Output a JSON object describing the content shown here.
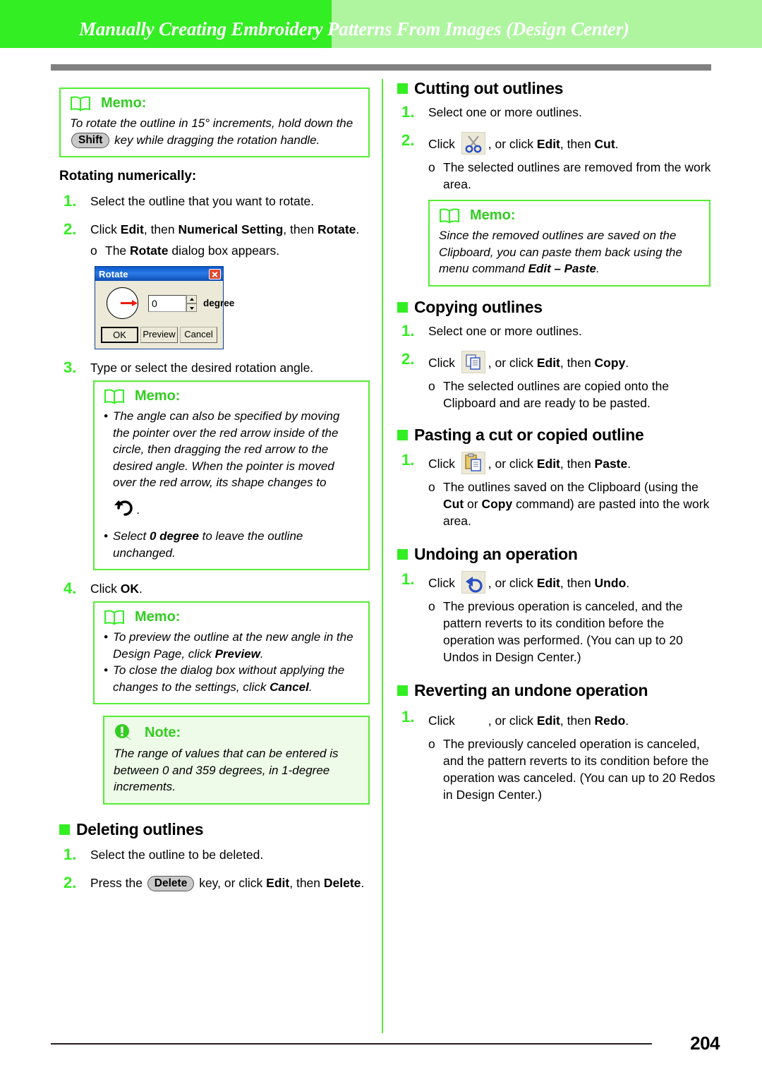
{
  "header": {
    "title": "Manually Creating Embroidery Patterns From Images (Design Center)",
    "color_dark": "#33ee22",
    "color_light": "#aff5a0"
  },
  "footer": {
    "page_number": "204"
  },
  "labels": {
    "memo": "Memo:",
    "note": "Note:",
    "book_icon": "book-icon",
    "warning_icon": "warning-icon"
  },
  "left_column": {
    "memo_rotate_increments": {
      "title": "Memo:",
      "text_before_key": "To rotate the outline in 15° increments, hold down the ",
      "key": "Shift",
      "text_after_key": " key while dragging the rotation handle."
    },
    "subheading_rotating_numerically": "Rotating numerically:",
    "steps": [
      {
        "num": "1.",
        "text": "Select the outline that you want to rotate."
      },
      {
        "num": "2.",
        "part1": "Click ",
        "b1": "Edit",
        "part2": ", then ",
        "b2": "Numerical Setting",
        "part3": ", then ",
        "b3": "Rotate",
        "part4": "."
      },
      {
        "num": "3.",
        "text": "Type or select the desired rotation angle."
      },
      {
        "num": "4.",
        "part1": "Click ",
        "b1": "OK",
        "part2": "."
      }
    ],
    "step2_sub": {
      "marker": "o",
      "part1": "The ",
      "b1": "Rotate",
      "part2": " dialog box appears."
    },
    "rotate_dialog": {
      "title": "Rotate",
      "close_icon": "close-icon",
      "value": "0",
      "unit_label": "degree",
      "buttons": [
        "OK",
        "Preview",
        "Cancel"
      ]
    },
    "memo_angle": {
      "title": "Memo:",
      "bullet1": "The angle can also be specified by moving the pointer over the red arrow inside of the circle, then dragging the red arrow to the desired angle. When the pointer is moved over the red arrow, its shape changes to",
      "bullet1_trailing": ".",
      "bullet2_part1": "Select ",
      "bullet2_bold": "0 degree",
      "bullet2_part2": " to leave the outline unchanged."
    },
    "memo_preview": {
      "title": "Memo:",
      "b1_part1": "To preview the outline at the new angle in the Design Page, click ",
      "b1_bold": "Preview",
      "b1_part2": ".",
      "b2_part1": "To close the dialog box without applying the changes to the settings, click ",
      "b2_bold": "Cancel",
      "b2_part2": "."
    },
    "note_range": {
      "title": "Note:",
      "text": "The range of values that can be entered is between 0 and 359 degrees, in 1-degree increments."
    },
    "deleting_outlines": {
      "heading": "Deleting outlines",
      "step1": {
        "num": "1.",
        "text": "Select the outline to be deleted."
      },
      "step2": {
        "num": "2.",
        "part1": "Press the ",
        "key": "Delete",
        "part2": " key, or click ",
        "b1": "Edit",
        "part3": ", then ",
        "b2": "Delete",
        "part4": "."
      }
    }
  },
  "right_column": {
    "cutting_out_outlines": {
      "heading": "Cutting out outlines",
      "step1": {
        "num": "1.",
        "text": "Select one or more outlines."
      },
      "step2": {
        "num": "2.",
        "part1": "Click ",
        "icon": "scissors-icon",
        "part2": ", or click ",
        "b1": "Edit",
        "part3": ", then ",
        "b2": "Cut",
        "part4": "."
      },
      "sub": {
        "marker": "o",
        "text": "The selected outlines are removed from the work area."
      },
      "memo": {
        "title": "Memo:",
        "part1": "Since the removed outlines are saved on the Clipboard, you can paste them back using the menu command ",
        "bold1": "Edit – Paste",
        "part2": "."
      }
    },
    "copying_outlines": {
      "heading": "Copying outlines",
      "step1": {
        "num": "1.",
        "text": "Select one or more outlines."
      },
      "step2": {
        "num": "2.",
        "part1": "Click ",
        "icon": "copy-icon",
        "part2": ", or click ",
        "b1": "Edit",
        "part3": ", then ",
        "b2": "Copy",
        "part4": "."
      },
      "sub": {
        "marker": "o",
        "text": "The selected outlines are copied onto the Clipboard and are ready to be pasted."
      }
    },
    "pasting_outline": {
      "heading": "Pasting a cut or copied outline",
      "step1": {
        "num": "1.",
        "part1": "Click ",
        "icon": "paste-icon",
        "part2": ", or click ",
        "b1": "Edit",
        "part3": ", then ",
        "b2": "Paste",
        "part4": "."
      },
      "sub": {
        "marker": "o",
        "part1": "The outlines saved on the Clipboard (using the ",
        "b1": "Cut",
        "part2": " or ",
        "b2": "Copy",
        "part3": " command) are pasted into the work area."
      }
    },
    "undoing_operation": {
      "heading": "Undoing an operation",
      "step1": {
        "num": "1.",
        "part1": "Click ",
        "icon": "undo-icon",
        "part2": ", or click ",
        "b1": "Edit",
        "part3": ", then ",
        "b2": "Undo",
        "part4": "."
      },
      "sub": {
        "marker": "o",
        "text": "The previous operation is canceled, and the pattern reverts to its condition before the operation was performed. (You can up to 20 Undos in Design Center.)"
      }
    },
    "reverting_operation": {
      "heading": "Reverting an undone operation",
      "step1": {
        "num": "1.",
        "part1": "Click ",
        "icon": "redo-icon",
        "part2": ", or click ",
        "b1": "Edit",
        "part3": ", then ",
        "b2": "Redo",
        "part4": "."
      },
      "sub": {
        "marker": "o",
        "text": "The previously canceled operation is canceled, and the pattern reverts to its condition before the operation was canceled. (You can up to 20 Redos in Design Center.)"
      }
    }
  }
}
